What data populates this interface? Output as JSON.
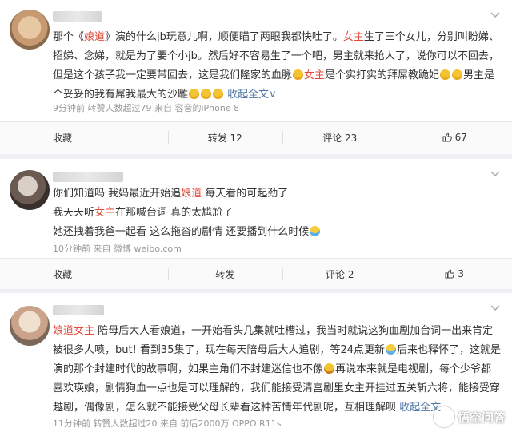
{
  "posts": [
    {
      "lines": [
        [
          {
            "t": "那个《"
          },
          {
            "t": "娘道",
            "c": "red"
          },
          {
            "t": "》演的什么jb玩意儿啊，顺便瞄了两眼我都快吐了。"
          },
          {
            "t": "女主",
            "c": "red"
          },
          {
            "t": "生了三个女儿，分别叫盼娣、"
          }
        ],
        [
          {
            "t": "招娣、念娣，就是为了要个小jb。然后好不容易生了一个吧，男主就来抢人了，说你可以不回去，"
          }
        ],
        [
          {
            "t": "但是这个孩子我一定要带回去，这是我们隆家的血脉"
          },
          {
            "e": "emoji"
          },
          {
            "t": ""
          },
          {
            "t": "女主",
            "c": "red"
          },
          {
            "t": "是个实打实的拜屌教跪妃"
          },
          {
            "e": "emoji"
          },
          {
            "e": "emoji"
          },
          {
            "t": "男主是"
          }
        ],
        [
          {
            "t": "个妥妥的我有屌我最大的沙雕"
          },
          {
            "e": "emoji"
          },
          {
            "e": "emoji"
          },
          {
            "e": "emoji"
          },
          {
            "t": " "
          },
          {
            "t": "收起全文",
            "c": "link"
          },
          {
            "t": "∨",
            "c": "link"
          }
        ]
      ],
      "meta": "9分钟前 转赞人数超过79 来自 容音的iPhone 8",
      "actions": {
        "collect": "收藏",
        "repost": "转发 12",
        "comment": "评论 23",
        "like": "67"
      }
    },
    {
      "lines": [
        [
          {
            "t": "你们知道吗 我妈最近开始追"
          },
          {
            "t": "娘道",
            "c": "red"
          },
          {
            "t": " 每天看的可起劲了"
          }
        ],
        [
          {
            "t": "我天天听"
          },
          {
            "t": "女主",
            "c": "red"
          },
          {
            "t": "在那喊台词 真的太尴尬了"
          }
        ],
        [
          {
            "t": "她还拽着我爸一起看 这么拖沓的剧情 还要播到什么时候"
          },
          {
            "e": "emoji lol"
          }
        ]
      ],
      "meta": "10分钟前 来自 微博 weibo.com",
      "actions": {
        "collect": "收藏",
        "repost": "转发",
        "comment": "评论 2",
        "like": "3"
      }
    },
    {
      "lines": [
        [
          {
            "t": "娘道",
            "c": "red"
          },
          {
            "t": "女主",
            "c": "red"
          },
          {
            "t": " 陪母后大人看娘道，一开始看头几集就吐槽过，我当时就说这狗血剧加台词一出来肯定"
          }
        ],
        [
          {
            "t": "被很多人喷，but! 看到35集了，现在每天陪母后大人追剧，等24点更新"
          },
          {
            "e": "emoji lol"
          },
          {
            "t": "后来也释怀了，这就是"
          }
        ],
        [
          {
            "t": "演的那个封建时代的故事啊，如果主角们不封建迷信也不像"
          },
          {
            "e": "emoji grin"
          },
          {
            "t": "再说本来就是电视剧，每个少爷都"
          }
        ],
        [
          {
            "t": "喜欢瑛娘，剧情狗血一点也是可以理解的，我们能接受清宫剧里女主开挂过五关斩六将，能接受穿"
          }
        ],
        [
          {
            "t": "越剧，偶像剧，怎么就不能接受父母长辈看这种苦情年代剧呢，互相理解呗"
          },
          {
            "t": " "
          },
          {
            "t": "收起全文",
            "c": "link"
          }
        ]
      ],
      "meta": "11分钟前 转赞人数超过20 来自 前后2000万 OPPO R11s",
      "actions": {
        "collect": "收藏",
        "repost": "转发",
        "comment": "评论",
        "like": ""
      }
    }
  ],
  "icons": {
    "chevron": "chevron-down-icon",
    "like": "thumbs-up-icon",
    "watermark": "toutiao-logo-icon"
  },
  "watermark": "悟空问答",
  "colors": {
    "red": "#e24a3b",
    "link": "#5079a8",
    "muted": "#999999"
  }
}
